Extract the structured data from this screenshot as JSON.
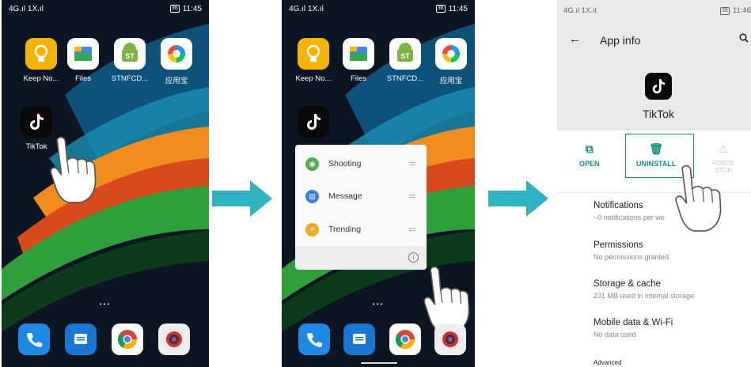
{
  "panel1": {
    "status": {
      "carrier": "4G.ıl 1X.ıl",
      "battery": "36",
      "time": "11:45"
    },
    "apps": [
      {
        "label": "Keep No...",
        "icon": "lightbulb-icon"
      },
      {
        "label": "Files",
        "icon": "files-icon"
      },
      {
        "label": "STNFCD...",
        "icon": "android-icon"
      },
      {
        "label": "应用宝",
        "icon": "app-store-icon"
      },
      {
        "label": "TikTok",
        "icon": "tiktok-icon"
      }
    ],
    "page_dots": "•••",
    "dock": [
      "phone-icon",
      "messages-icon",
      "chrome-icon",
      "camera-icon"
    ]
  },
  "panel2": {
    "status": {
      "carrier": "4G.ıl 1X.ıl",
      "battery": "36",
      "time": "11:45"
    },
    "apps": [
      {
        "label": "Keep No...",
        "icon": "lightbulb-icon"
      },
      {
        "label": "Files",
        "icon": "files-icon"
      },
      {
        "label": "STNFCD...",
        "icon": "android-icon"
      },
      {
        "label": "应用宝",
        "icon": "app-store-icon"
      }
    ],
    "shortcuts": [
      {
        "label": "Shooting",
        "color": "#4caf50",
        "icon": "camera-icon"
      },
      {
        "label": "Message",
        "color": "#3b7de0",
        "icon": "message-icon"
      },
      {
        "label": "Trending",
        "color": "#f5a623",
        "icon": "hashtag-icon"
      }
    ],
    "page_dots": "•••"
  },
  "panel3": {
    "status": {
      "carrier": "4G.ıl 1X.ıl",
      "battery": "36",
      "time": "11:46"
    },
    "title": "App info",
    "app_name": "TikTok",
    "actions": {
      "open": "OPEN",
      "uninstall": "UNINSTALL",
      "force_stop_line1": "FORCE",
      "force_stop_line2": "STOP"
    },
    "rows": [
      {
        "title": "Notifications",
        "subtitle": "~0 notifications per we"
      },
      {
        "title": "Permissions",
        "subtitle": "No permissions granted"
      },
      {
        "title": "Storage & cache",
        "subtitle": "231 MB used in internal storage"
      },
      {
        "title": "Mobile data & Wi-Fi",
        "subtitle": "No data used"
      },
      {
        "title": "Advanced",
        "subtitle": ""
      }
    ]
  },
  "colors": {
    "arrow": "#2fb3c0",
    "accent": "#16907e",
    "tiktok": "#0a0a0a"
  }
}
